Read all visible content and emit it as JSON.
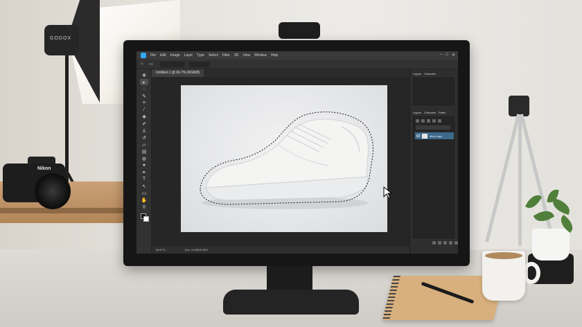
{
  "scene": {
    "light_brand": "GODOX",
    "camera_brand": "Nikon"
  },
  "photoshop": {
    "menu": [
      "File",
      "Edit",
      "Image",
      "Layer",
      "Type",
      "Select",
      "Filter",
      "3D",
      "View",
      "Window",
      "Help"
    ],
    "window_controls": [
      "–",
      "□",
      "✕"
    ],
    "options": {
      "field1": "",
      "field2": ""
    },
    "document_tab": "Untitled-1 @ 66.7% (RGB/8)",
    "status": {
      "zoom": "66.67%",
      "doc_info": "Doc: 5.49M/5.49M"
    },
    "panels": {
      "top_tabs": [
        "Layers",
        "Channels"
      ],
      "layers_tabs": [
        "Layers",
        "Channels",
        "Paths"
      ],
      "layer_name": "shoe copy"
    },
    "tools": [
      "move",
      "marquee",
      "lasso",
      "quick-select",
      "crop",
      "eyedropper",
      "healing",
      "brush",
      "stamp",
      "history",
      "eraser",
      "gradient",
      "blur",
      "dodge",
      "pen",
      "type",
      "path-select",
      "shape",
      "hand",
      "zoom"
    ]
  },
  "colors": {
    "accent": "#31a8ff",
    "selected_layer": "#3d6a8a"
  }
}
